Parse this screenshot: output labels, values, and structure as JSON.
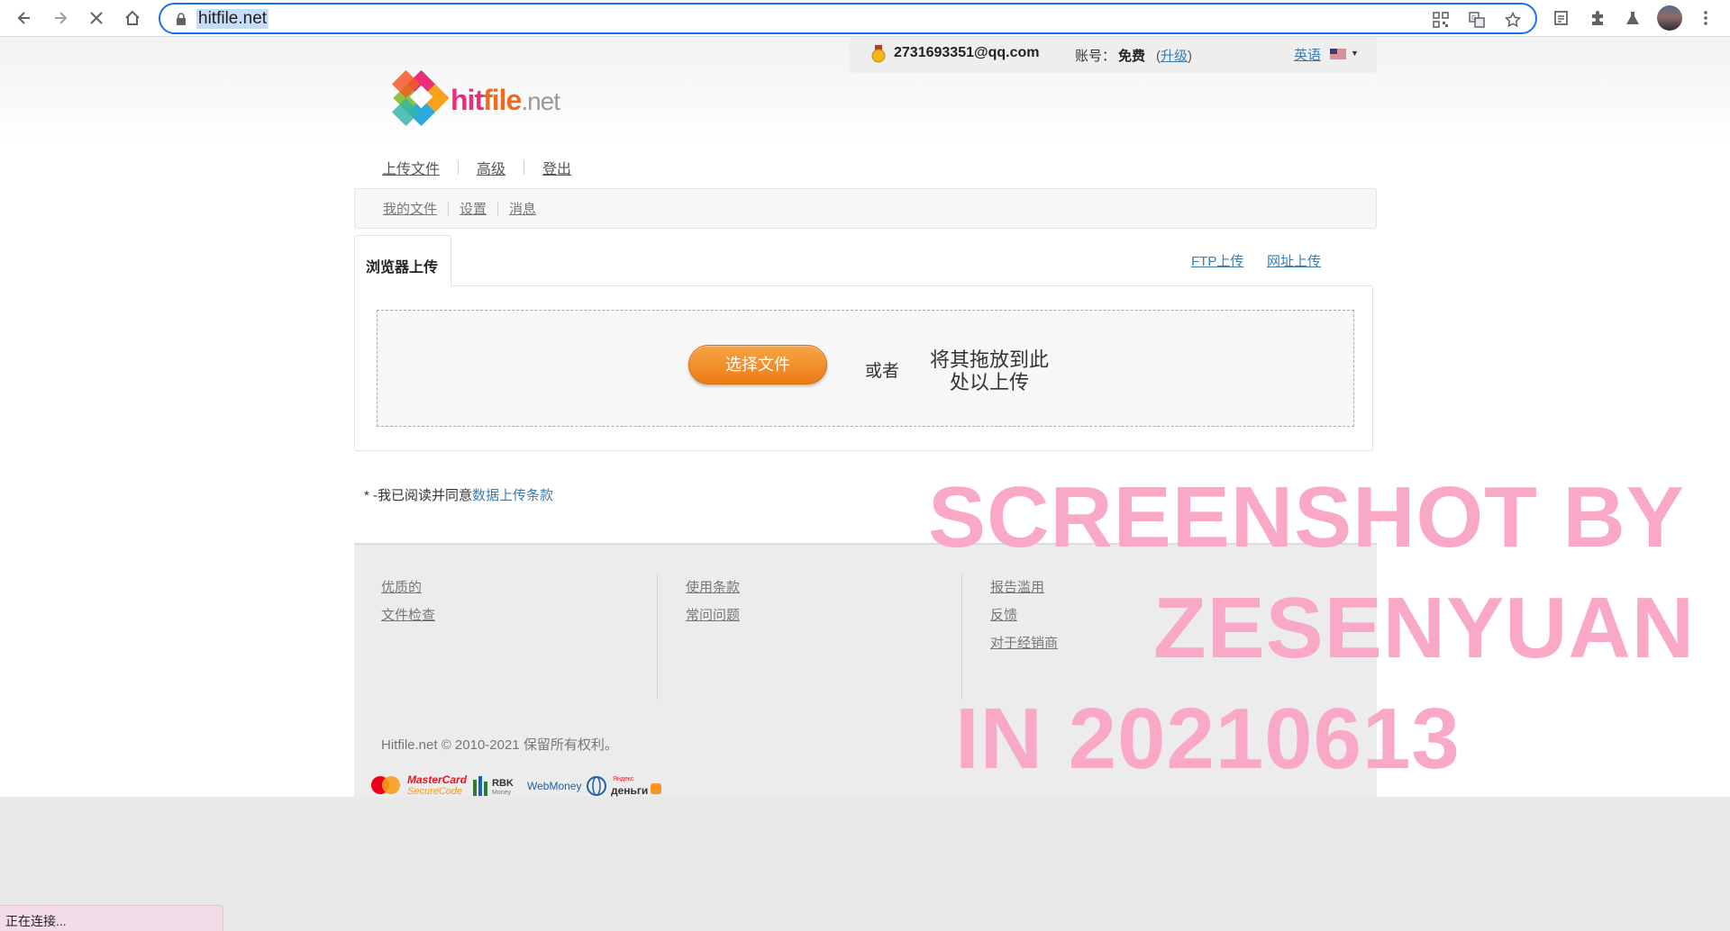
{
  "browser": {
    "url": "hitfile.net",
    "colors": {
      "accent": "#1a73e8",
      "url_highlight": "#c8dbf7"
    },
    "icons": [
      "back-icon",
      "forward-icon",
      "stop-icon",
      "home-icon",
      "lock-icon",
      "qr-code-icon",
      "translate-icon",
      "bookmark-star-icon",
      "tab-search-icon",
      "extensions-icon",
      "profile-flask-icon",
      "avatar",
      "menu-icon"
    ]
  },
  "userbar": {
    "email": "2731693351@qq.com",
    "account_label": "账号：",
    "account_type": "免费",
    "upgrade_open": "(",
    "upgrade": "升级",
    "upgrade_close": ")",
    "language": "英语"
  },
  "logo": {
    "hit": "hit",
    "file": "file",
    "net": ".net"
  },
  "main_nav": [
    "上传文件",
    "高级",
    "登出"
  ],
  "sub_nav": [
    "我的文件",
    "设置",
    "消息"
  ],
  "upload": {
    "tab_browser": "浏览器上传",
    "ftp_link": "FTP上传",
    "url_link": "网址上传",
    "choose_button": "选择文件",
    "or": "或者",
    "drag_line1": "将其拖放到此",
    "drag_line2": "处以上传",
    "colors": {
      "button": "#ec7c16",
      "link": "#3b7cb1"
    }
  },
  "agreement": {
    "prefix": "* -我已阅读并同意",
    "link": "数据上传条款"
  },
  "footer": {
    "col1": [
      "优质的",
      "文件检查"
    ],
    "col2": [
      "使用条款",
      "常问问题"
    ],
    "col3": [
      "报告滥用",
      "反馈",
      "对于经销商"
    ],
    "copyright": "Hitfile.net © 2010-2021 保留所有权利。",
    "payments": {
      "mastercard_line1": "MasterCard",
      "mastercard_line2": "SecureCode",
      "rbk": "RBK",
      "rbk_sub": "Money",
      "webmoney": "WebMoney",
      "yandex": "Яндекс",
      "dengi": "деньги"
    }
  },
  "watermark": {
    "line1": "SCREENSHOT BY",
    "line2": "ZESENYUAN",
    "line3": "IN 20210613",
    "color": "#f9a8c8"
  },
  "status": "正在连接..."
}
